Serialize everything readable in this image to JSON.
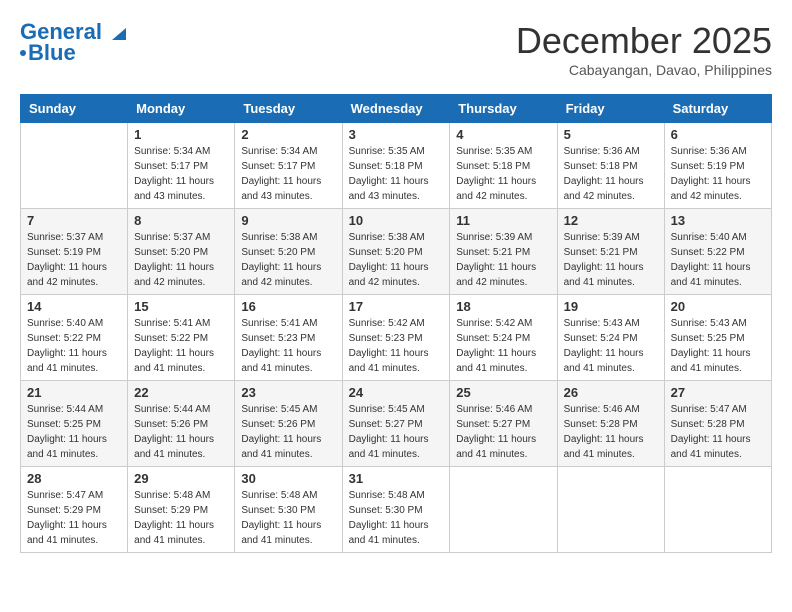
{
  "header": {
    "logo_line1": "General",
    "logo_line2": "Blue",
    "month": "December 2025",
    "location": "Cabayangan, Davao, Philippines"
  },
  "days_of_week": [
    "Sunday",
    "Monday",
    "Tuesday",
    "Wednesday",
    "Thursday",
    "Friday",
    "Saturday"
  ],
  "weeks": [
    [
      {
        "day": "",
        "sunrise": "",
        "sunset": "",
        "daylight": ""
      },
      {
        "day": "1",
        "sunrise": "Sunrise: 5:34 AM",
        "sunset": "Sunset: 5:17 PM",
        "daylight": "Daylight: 11 hours and 43 minutes."
      },
      {
        "day": "2",
        "sunrise": "Sunrise: 5:34 AM",
        "sunset": "Sunset: 5:17 PM",
        "daylight": "Daylight: 11 hours and 43 minutes."
      },
      {
        "day": "3",
        "sunrise": "Sunrise: 5:35 AM",
        "sunset": "Sunset: 5:18 PM",
        "daylight": "Daylight: 11 hours and 43 minutes."
      },
      {
        "day": "4",
        "sunrise": "Sunrise: 5:35 AM",
        "sunset": "Sunset: 5:18 PM",
        "daylight": "Daylight: 11 hours and 42 minutes."
      },
      {
        "day": "5",
        "sunrise": "Sunrise: 5:36 AM",
        "sunset": "Sunset: 5:18 PM",
        "daylight": "Daylight: 11 hours and 42 minutes."
      },
      {
        "day": "6",
        "sunrise": "Sunrise: 5:36 AM",
        "sunset": "Sunset: 5:19 PM",
        "daylight": "Daylight: 11 hours and 42 minutes."
      }
    ],
    [
      {
        "day": "7",
        "sunrise": "Sunrise: 5:37 AM",
        "sunset": "Sunset: 5:19 PM",
        "daylight": "Daylight: 11 hours and 42 minutes."
      },
      {
        "day": "8",
        "sunrise": "Sunrise: 5:37 AM",
        "sunset": "Sunset: 5:20 PM",
        "daylight": "Daylight: 11 hours and 42 minutes."
      },
      {
        "day": "9",
        "sunrise": "Sunrise: 5:38 AM",
        "sunset": "Sunset: 5:20 PM",
        "daylight": "Daylight: 11 hours and 42 minutes."
      },
      {
        "day": "10",
        "sunrise": "Sunrise: 5:38 AM",
        "sunset": "Sunset: 5:20 PM",
        "daylight": "Daylight: 11 hours and 42 minutes."
      },
      {
        "day": "11",
        "sunrise": "Sunrise: 5:39 AM",
        "sunset": "Sunset: 5:21 PM",
        "daylight": "Daylight: 11 hours and 42 minutes."
      },
      {
        "day": "12",
        "sunrise": "Sunrise: 5:39 AM",
        "sunset": "Sunset: 5:21 PM",
        "daylight": "Daylight: 11 hours and 41 minutes."
      },
      {
        "day": "13",
        "sunrise": "Sunrise: 5:40 AM",
        "sunset": "Sunset: 5:22 PM",
        "daylight": "Daylight: 11 hours and 41 minutes."
      }
    ],
    [
      {
        "day": "14",
        "sunrise": "Sunrise: 5:40 AM",
        "sunset": "Sunset: 5:22 PM",
        "daylight": "Daylight: 11 hours and 41 minutes."
      },
      {
        "day": "15",
        "sunrise": "Sunrise: 5:41 AM",
        "sunset": "Sunset: 5:22 PM",
        "daylight": "Daylight: 11 hours and 41 minutes."
      },
      {
        "day": "16",
        "sunrise": "Sunrise: 5:41 AM",
        "sunset": "Sunset: 5:23 PM",
        "daylight": "Daylight: 11 hours and 41 minutes."
      },
      {
        "day": "17",
        "sunrise": "Sunrise: 5:42 AM",
        "sunset": "Sunset: 5:23 PM",
        "daylight": "Daylight: 11 hours and 41 minutes."
      },
      {
        "day": "18",
        "sunrise": "Sunrise: 5:42 AM",
        "sunset": "Sunset: 5:24 PM",
        "daylight": "Daylight: 11 hours and 41 minutes."
      },
      {
        "day": "19",
        "sunrise": "Sunrise: 5:43 AM",
        "sunset": "Sunset: 5:24 PM",
        "daylight": "Daylight: 11 hours and 41 minutes."
      },
      {
        "day": "20",
        "sunrise": "Sunrise: 5:43 AM",
        "sunset": "Sunset: 5:25 PM",
        "daylight": "Daylight: 11 hours and 41 minutes."
      }
    ],
    [
      {
        "day": "21",
        "sunrise": "Sunrise: 5:44 AM",
        "sunset": "Sunset: 5:25 PM",
        "daylight": "Daylight: 11 hours and 41 minutes."
      },
      {
        "day": "22",
        "sunrise": "Sunrise: 5:44 AM",
        "sunset": "Sunset: 5:26 PM",
        "daylight": "Daylight: 11 hours and 41 minutes."
      },
      {
        "day": "23",
        "sunrise": "Sunrise: 5:45 AM",
        "sunset": "Sunset: 5:26 PM",
        "daylight": "Daylight: 11 hours and 41 minutes."
      },
      {
        "day": "24",
        "sunrise": "Sunrise: 5:45 AM",
        "sunset": "Sunset: 5:27 PM",
        "daylight": "Daylight: 11 hours and 41 minutes."
      },
      {
        "day": "25",
        "sunrise": "Sunrise: 5:46 AM",
        "sunset": "Sunset: 5:27 PM",
        "daylight": "Daylight: 11 hours and 41 minutes."
      },
      {
        "day": "26",
        "sunrise": "Sunrise: 5:46 AM",
        "sunset": "Sunset: 5:28 PM",
        "daylight": "Daylight: 11 hours and 41 minutes."
      },
      {
        "day": "27",
        "sunrise": "Sunrise: 5:47 AM",
        "sunset": "Sunset: 5:28 PM",
        "daylight": "Daylight: 11 hours and 41 minutes."
      }
    ],
    [
      {
        "day": "28",
        "sunrise": "Sunrise: 5:47 AM",
        "sunset": "Sunset: 5:29 PM",
        "daylight": "Daylight: 11 hours and 41 minutes."
      },
      {
        "day": "29",
        "sunrise": "Sunrise: 5:48 AM",
        "sunset": "Sunset: 5:29 PM",
        "daylight": "Daylight: 11 hours and 41 minutes."
      },
      {
        "day": "30",
        "sunrise": "Sunrise: 5:48 AM",
        "sunset": "Sunset: 5:30 PM",
        "daylight": "Daylight: 11 hours and 41 minutes."
      },
      {
        "day": "31",
        "sunrise": "Sunrise: 5:48 AM",
        "sunset": "Sunset: 5:30 PM",
        "daylight": "Daylight: 11 hours and 41 minutes."
      },
      {
        "day": "",
        "sunrise": "",
        "sunset": "",
        "daylight": ""
      },
      {
        "day": "",
        "sunrise": "",
        "sunset": "",
        "daylight": ""
      },
      {
        "day": "",
        "sunrise": "",
        "sunset": "",
        "daylight": ""
      }
    ]
  ]
}
